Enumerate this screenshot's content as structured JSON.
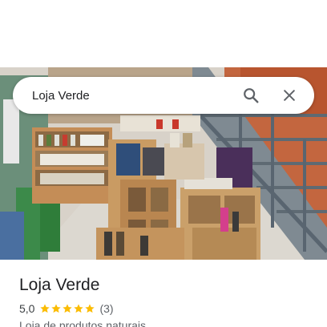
{
  "search": {
    "query": "Loja Verde"
  },
  "place": {
    "title": "Loja Verde",
    "rating": "5,0",
    "stars_filled": 5,
    "stars_total": 5,
    "review_count": "(3)",
    "category": "Loja de produtos naturais"
  },
  "colors": {
    "star": "#fbbc04",
    "icon": "#5f6368",
    "text_primary": "#202124",
    "text_secondary": "#5f6368"
  },
  "icons": {
    "search": "search-icon",
    "close": "close-icon",
    "star": "star-icon"
  }
}
